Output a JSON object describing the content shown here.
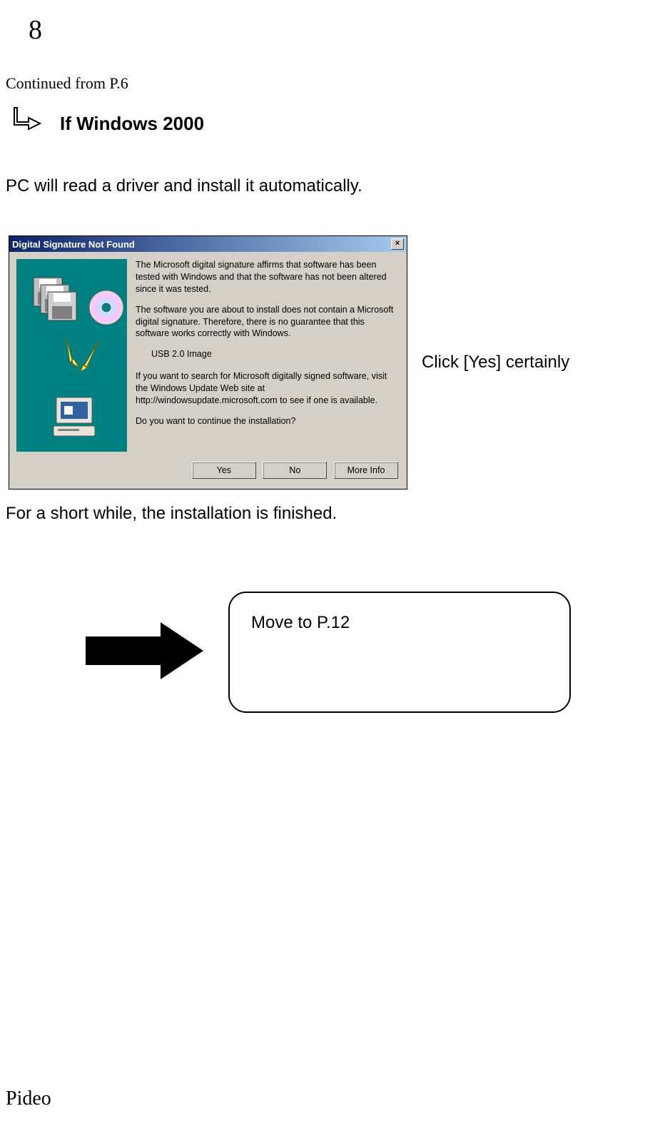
{
  "page_number": "8",
  "continued_text": "Continued from P.6",
  "section_heading": "If Windows 2000",
  "intro_text": "PC will read a driver and install it automatically.",
  "dialog": {
    "title": "Digital Signature Not Found",
    "close_x": "×",
    "para1": "The Microsoft digital signature affirms that software has been tested with Windows and that the software has not been altered since it was tested.",
    "para2": "The software you are about to install does not contain a Microsoft digital signature. Therefore,  there is no guarantee that this software works correctly with Windows.",
    "device_name": "USB 2.0 Image",
    "para3": "If you want to search for Microsoft digitally signed software, visit the Windows Update Web site at http://windowsupdate.microsoft.com to see if one is available.",
    "para4": "Do you want to continue the installation?",
    "btn_yes": "Yes",
    "btn_no": "No",
    "btn_more": "More Info"
  },
  "click_yes_text": "Click [Yes] certainly",
  "finished_text": "For a short while, the installation is finished.",
  "move_to_text": "Move to   P.12",
  "brand": "Pideo"
}
